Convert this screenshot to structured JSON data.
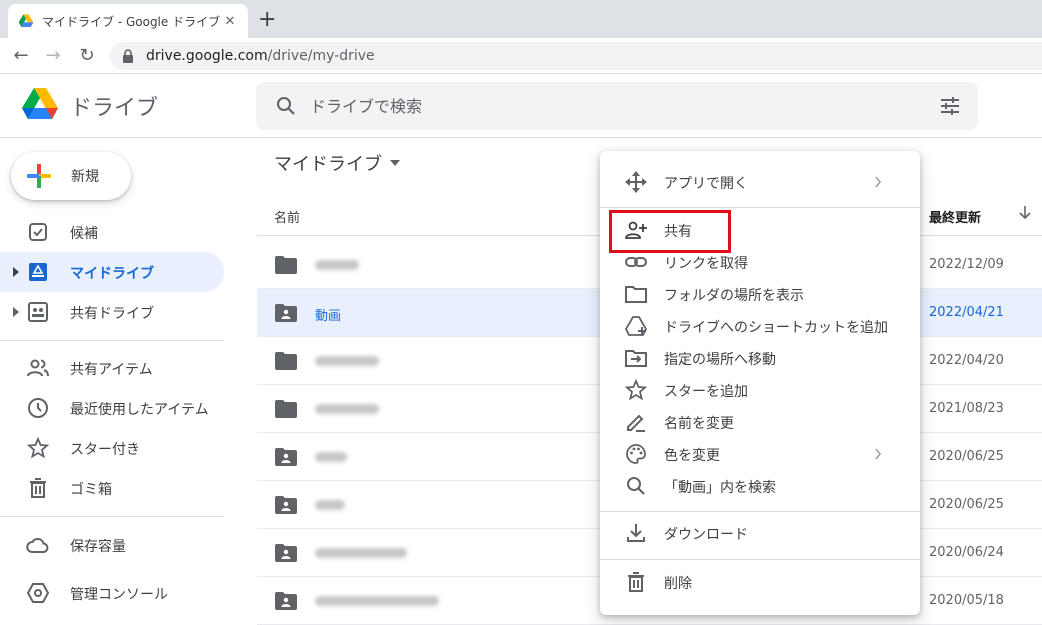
{
  "browser": {
    "tab_title": "マイドライブ - Google ドライブ",
    "close_glyph": "✕",
    "new_tab_glyph": "+",
    "back_glyph": "←",
    "forward_glyph": "→",
    "reload_glyph": "↻",
    "url_host": "drive.google.com",
    "url_path": "/drive/my-drive"
  },
  "header": {
    "brand": "ドライブ",
    "search_placeholder": "ドライブで検索"
  },
  "sidebar": {
    "new_label": "新規",
    "items": [
      {
        "label": "候補",
        "icon": "suggested-icon"
      },
      {
        "label": "マイドライブ",
        "icon": "my-drive-icon",
        "active": true
      },
      {
        "label": "共有ドライブ",
        "icon": "shared-drive-icon"
      },
      {
        "label": "共有アイテム",
        "icon": "people-icon"
      },
      {
        "label": "最近使用したアイテム",
        "icon": "clock-icon"
      },
      {
        "label": "スター付き",
        "icon": "star-icon"
      },
      {
        "label": "ゴミ箱",
        "icon": "trash-icon"
      },
      {
        "label": "保存容量",
        "icon": "cloud-icon"
      },
      {
        "label": "管理コンソール",
        "icon": "admin-icon"
      }
    ]
  },
  "main": {
    "title": "マイドライブ",
    "col_name": "名前",
    "col_modified": "最終更新",
    "rows": [
      {
        "name": "",
        "modified": "2022/12/09"
      },
      {
        "name": "動画",
        "modified": "2022/04/21"
      },
      {
        "name": "",
        "modified": "2022/04/20"
      },
      {
        "name": "",
        "modified": "2021/08/23"
      },
      {
        "name": "",
        "modified": "2020/06/25"
      },
      {
        "name": "",
        "modified": "2020/06/25"
      },
      {
        "name": "",
        "modified": "2020/06/24"
      },
      {
        "name": "",
        "modified": "2020/05/18"
      }
    ]
  },
  "context_menu": {
    "items": [
      {
        "label": "アプリで開く",
        "icon": "move-arrows-icon"
      },
      {
        "label": "共有",
        "icon": "person-add-icon"
      },
      {
        "label": "リンクを取得",
        "icon": "link-icon"
      },
      {
        "label": "フォルダの場所を表示",
        "icon": "folder-outline-icon"
      },
      {
        "label": "ドライブへのショートカットを追加",
        "icon": "drive-shortcut-icon"
      },
      {
        "label": "指定の場所へ移動",
        "icon": "move-to-icon"
      },
      {
        "label": "スターを追加",
        "icon": "star-outline-icon"
      },
      {
        "label": "名前を変更",
        "icon": "pencil-icon"
      },
      {
        "label": "色を変更",
        "icon": "palette-icon"
      },
      {
        "label": "「動画」内を検索",
        "icon": "search-icon"
      },
      {
        "label": "ダウンロード",
        "icon": "download-icon"
      },
      {
        "label": "削除",
        "icon": "trash-icon"
      }
    ]
  },
  "colors": {
    "accent": "#1967d2",
    "highlight_box": "#e10e1a",
    "selected_row": "#e8f0fe"
  }
}
